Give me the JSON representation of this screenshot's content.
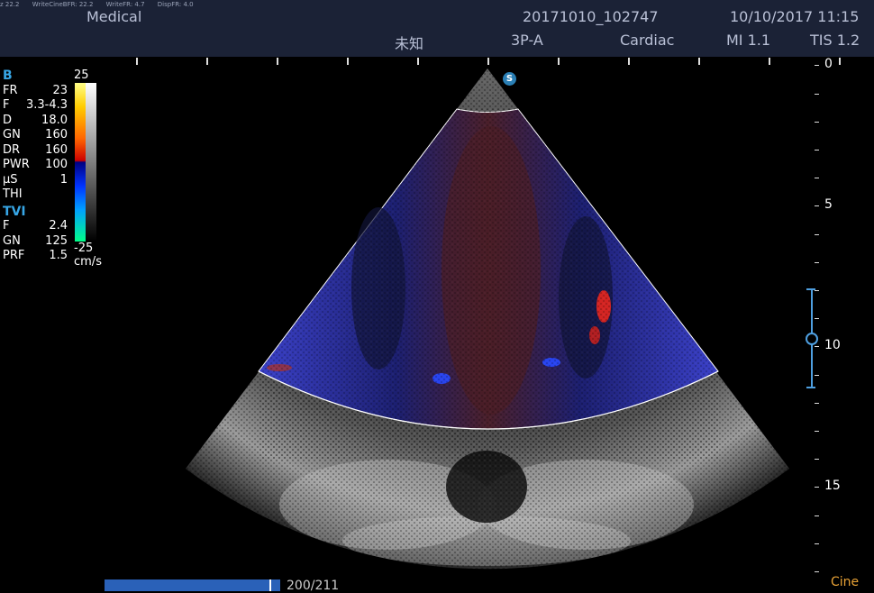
{
  "header": {
    "debug": [
      "z 22.2",
      "WriteCineBFR: 22.2",
      "WriteFR: 4.7",
      "DispFR: 4.0"
    ],
    "institution": "Medical",
    "patient_id": "20171010_102747",
    "datetime": "10/10/2017 11:15",
    "patient_name": "未知",
    "probe": "3P-A",
    "preset": "Cardiac",
    "mi": "MI 1.1",
    "tis": "TIS 1.2"
  },
  "b_mode": {
    "title": "B",
    "params": [
      {
        "label": "FR",
        "value": "23"
      },
      {
        "label": "F",
        "value": "3.3-4.3"
      },
      {
        "label": "D",
        "value": "18.0"
      },
      {
        "label": "GN",
        "value": "160"
      },
      {
        "label": "DR",
        "value": "160"
      },
      {
        "label": "PWR",
        "value": "100"
      },
      {
        "label": "μS",
        "value": "1"
      },
      {
        "label": "THI",
        "value": ""
      }
    ]
  },
  "tvi_mode": {
    "title": "TVI",
    "params": [
      {
        "label": "F",
        "value": "2.4"
      },
      {
        "label": "GN",
        "value": "125"
      },
      {
        "label": "PRF",
        "value": "1.5"
      }
    ]
  },
  "colorbar": {
    "top_label": "25",
    "bottom_label": "-25",
    "unit": "cm/s"
  },
  "depth_scale": {
    "labels": [
      "0",
      "5",
      "10",
      "15"
    ]
  },
  "focus_marker": {
    "level": 10
  },
  "cine": {
    "frame_label": "200/211",
    "current_frame": 200,
    "total_frames": 211,
    "mode_label": "Cine"
  },
  "sector_badge": "S",
  "colors": {
    "header_bg": "#1b2236",
    "accent_blue": "#37a6e6",
    "cine_orange": "#e8a236",
    "progress_blue": "#2a61b8"
  }
}
